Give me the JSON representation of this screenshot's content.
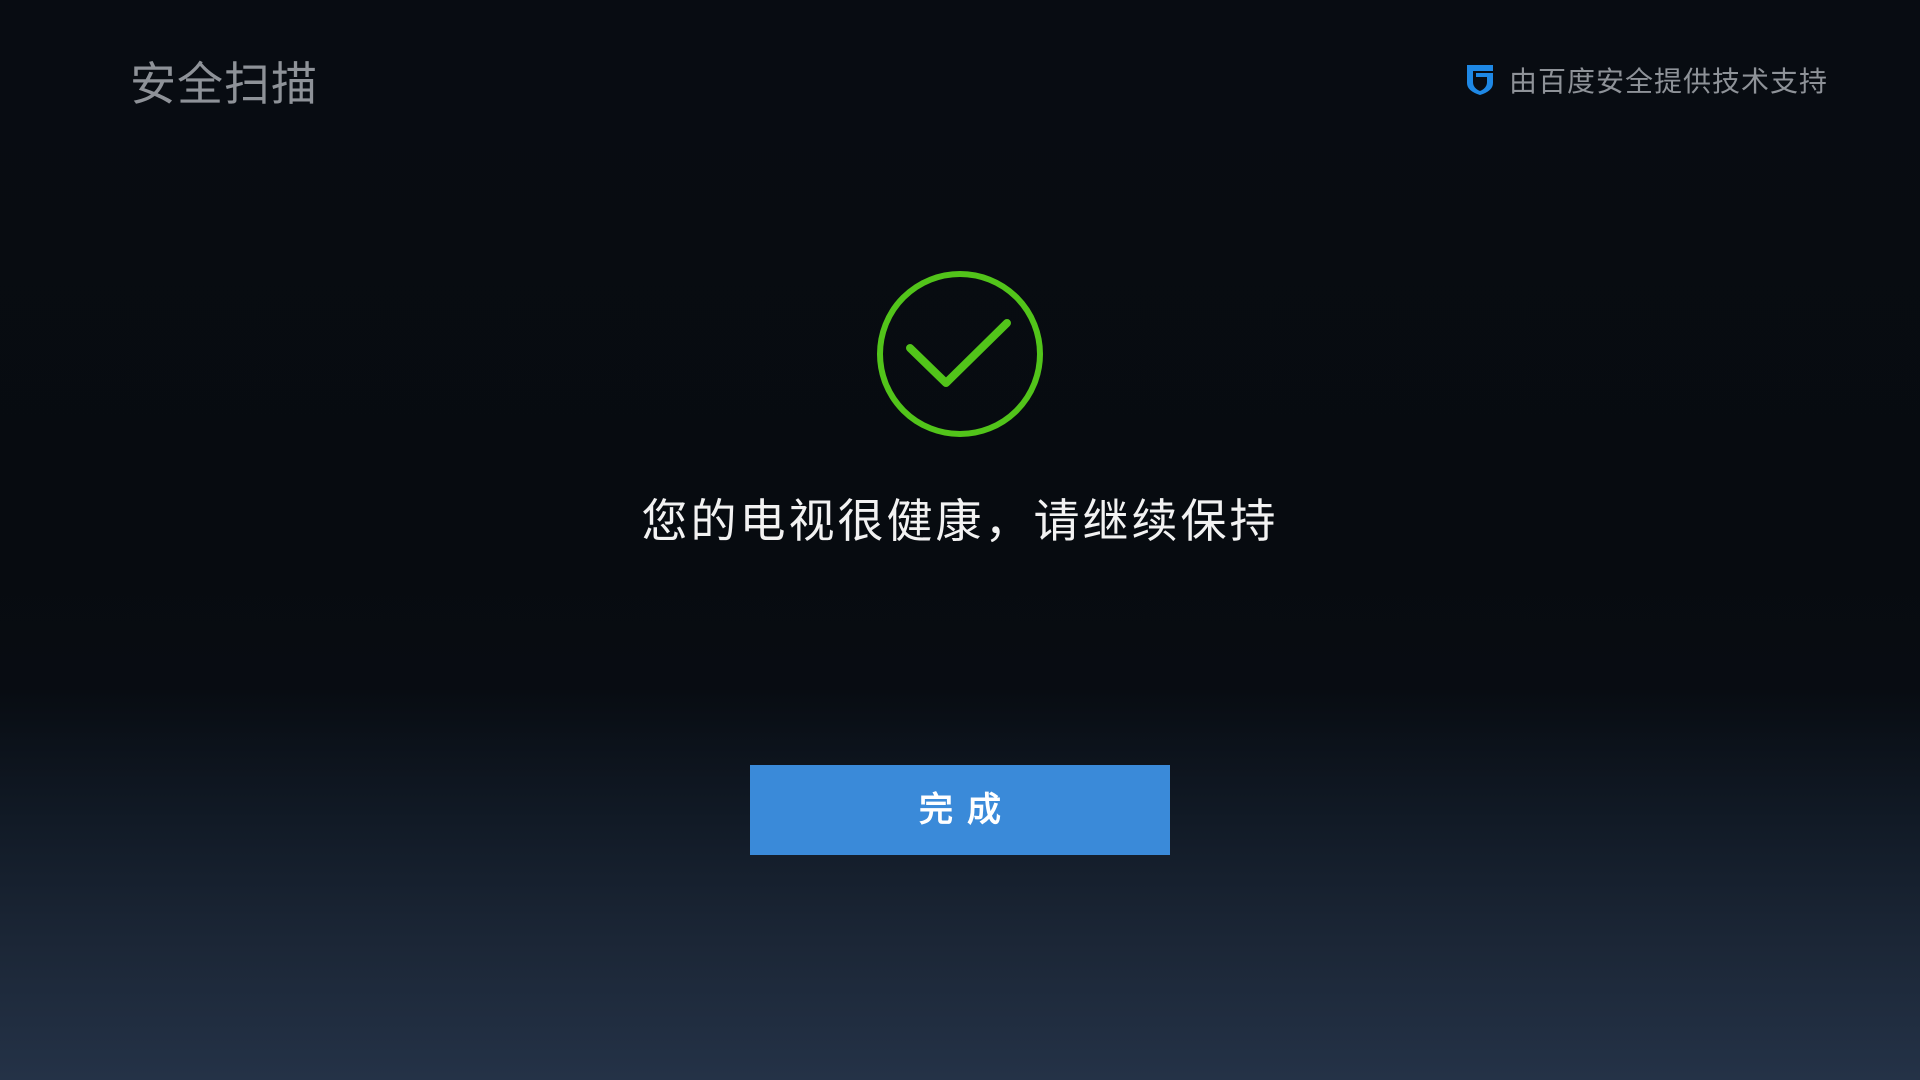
{
  "header": {
    "title": "安全扫描",
    "provider_text": "由百度安全提供技术支持",
    "provider_icon": "baidu-security-shield-icon"
  },
  "result": {
    "icon": "checkmark-circle-icon",
    "message": "您的电视很健康，请继续保持"
  },
  "actions": {
    "done_label": "完成"
  },
  "colors": {
    "success_green": "#52c41a",
    "button_blue": "#3a8ad9",
    "provider_icon_blue": "#1e88e5",
    "muted_text": "#8e9298"
  }
}
